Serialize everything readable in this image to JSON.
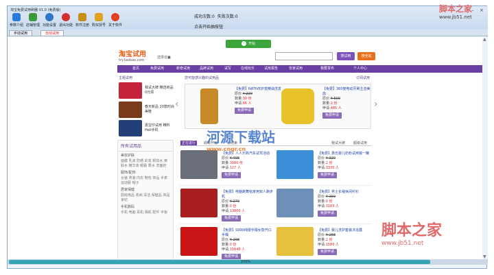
{
  "window": {
    "title": "淘宝免费试用刷器 V1.0 (免费版)"
  },
  "toolbar": [
    {
      "label": "参数介绍",
      "icon": "info-icon",
      "color": "#2a7ad8"
    },
    {
      "label": "店铺管理",
      "icon": "store-icon",
      "color": "#3a9a3a"
    },
    {
      "label": "功能设置",
      "icon": "settings-icon",
      "color": "#3077c8"
    },
    {
      "label": "退出功能",
      "icon": "exit-icon",
      "color": "#d03030"
    },
    {
      "label": "软件注册",
      "icon": "key-icon",
      "color": "#c89018"
    },
    {
      "label": "购买授号",
      "icon": "trophy-icon",
      "color": "#e0a020"
    },
    {
      "label": "关于软件",
      "icon": "about-icon",
      "color": "#e04020"
    }
  ],
  "status": {
    "success_label": "成功次数:",
    "success_count": "0",
    "fail_label": "失败次数:",
    "fail_count": "0",
    "hint": "点击开始抽按钮"
  },
  "tabs": [
    {
      "label": "手动试用"
    },
    {
      "label": "自动试用",
      "active": true
    }
  ],
  "browser": {
    "start_button": "开始",
    "logo": "淘宝试用",
    "logo_sub": "try.taobao.com",
    "location": "选择省■",
    "search_btn": "搜试用",
    "shop_btn": "搜全站",
    "nav": [
      "首页",
      "免费试用",
      "新奇试用",
      "品牌试用",
      "试写",
      "在线玩乐",
      "试用报告",
      "安家试用",
      "我要发布",
      "个人中心"
    ],
    "left_title": "主题试用",
    "categories": [
      {
        "text": "我试大牌 精选商品0元领",
        "color": "#c4223a"
      },
      {
        "text": "春天新品 20款时尚美鞋",
        "color": "#7a3b1c"
      },
      {
        "text": "嘉宝印试用 精料Heli手机",
        "color": "#233f7a"
      }
    ],
    "featured_title": "您可能感兴趣的试用品",
    "featured_link": "订阅试用",
    "featured": [
      {
        "title": "【免费】NATIVE护发精油洗发",
        "price_label": "原价:",
        "price": "¥ 220",
        "qty_label": "数量:",
        "qty": "30 份",
        "apply_label": "申请:",
        "apply_count": "66 人",
        "button": "免费申请",
        "color": "#c68a28"
      },
      {
        "title": "【免费】360度电动牙刷主洁美齿",
        "price_label": "原价:",
        "price": "¥ 500",
        "qty_label": "数量:",
        "qty": "2 份",
        "apply_label": "申请:",
        "apply_count": "485 人",
        "button": "免费申请",
        "color": "#e7c22a"
      }
    ],
    "catalog_title": "所有试用品",
    "catalog": [
      {
        "group": "美容护肤",
        "items": "面膜 乳液 防晒 彩妆 卸妆水 爽肤水 精华液 眼霜 香水 洗面奶"
      },
      {
        "group": "服饰/配饰",
        "items": "女装 男装 内衣 鞋包 饰品 手表 运动服 帽子"
      },
      {
        "group": "居家保健",
        "items": "厨房用品 收纳 清洁 保健品 床品 家纺"
      },
      {
        "group": "手机数码",
        "items": "手机 电脑 耳机 相机 配件 平板"
      }
    ],
    "grid_tabs": [
      "正在进行",
      "即将开始",
      "已结束",
      "我试大牌",
      "超级试用"
    ],
    "grid": [
      {
        "title": "【免费】人人乐购汽车试驾活动",
        "price_label": "原价:",
        "price": "¥ 498",
        "qty_label": "数量:",
        "qty": "3000 份",
        "apply_label": "申请:",
        "apply_count": "127 人",
        "button": "免费申请",
        "color": "#6b6f7a"
      },
      {
        "title": "【免费】惠氏婴儿奶粉试用装一罐",
        "price_label": "原价:",
        "price": "¥ 320",
        "qty_label": "数量:",
        "qty": "2 份",
        "apply_label": "申请:",
        "apply_count": "3335 人",
        "button": "免费申请",
        "color": "#3a8fd8"
      },
      {
        "title": "【免费】电脑跳舞毯家用双人跑步机",
        "price_label": "原价:",
        "price": "¥ 270",
        "qty_label": "数量:",
        "qty": "0 份",
        "apply_label": "申请:",
        "apply_count": "13800 人",
        "button": "免费申请",
        "color": "#a81e1e"
      },
      {
        "title": "【免费】男士长袖休闲衬衫",
        "price_label": "原价:",
        "price": "¥ 159",
        "qty_label": "数量:",
        "qty": "0 份",
        "apply_label": "申请:",
        "apply_count": "3183 人",
        "button": "免费申请",
        "color": "#6d8fb8"
      },
      {
        "title": "【免费】S999纯银手镯女款开口手镯",
        "price_label": "原价:",
        "price": "¥ 298",
        "qty_label": "数量:",
        "qty": "0 份",
        "apply_label": "申请:",
        "apply_count": "15648 人",
        "button": "免费申请",
        "color": "#c81414"
      },
      {
        "title": "【免费】婴儿洗护套装沐浴露",
        "price_label": "原价:",
        "price": "¥ 268",
        "qty_label": "数量:",
        "qty": "2 份",
        "apply_label": "申请:",
        "apply_count": "1580 人",
        "button": "免费申请",
        "color": "#e8c040"
      }
    ]
  },
  "scrollbar": {
    "label": "100%"
  },
  "watermarks": {
    "top_right": "脚本之家",
    "top_right_url": "www.jb51.net",
    "center": "河源下载站",
    "center_url": "www.cngr.cn",
    "bottom_right": "脚本之家",
    "bottom_right_url": "www.jb51.net"
  }
}
